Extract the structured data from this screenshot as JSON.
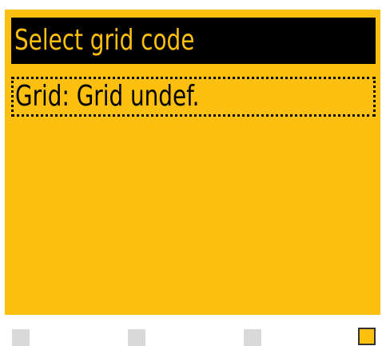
{
  "screen": {
    "title": "Select grid code",
    "items": [
      {
        "label": "Grid: Grid undef.",
        "selected": true
      }
    ]
  },
  "colors": {
    "background": "#fdc00e",
    "title_bg": "#000000",
    "key_inactive": "#d9d9d9",
    "key_active": "#fdc00e"
  },
  "softkeys": [
    {
      "name": "softkey-1",
      "active": false
    },
    {
      "name": "softkey-2",
      "active": false
    },
    {
      "name": "softkey-3",
      "active": false
    },
    {
      "name": "softkey-4",
      "active": true
    }
  ]
}
